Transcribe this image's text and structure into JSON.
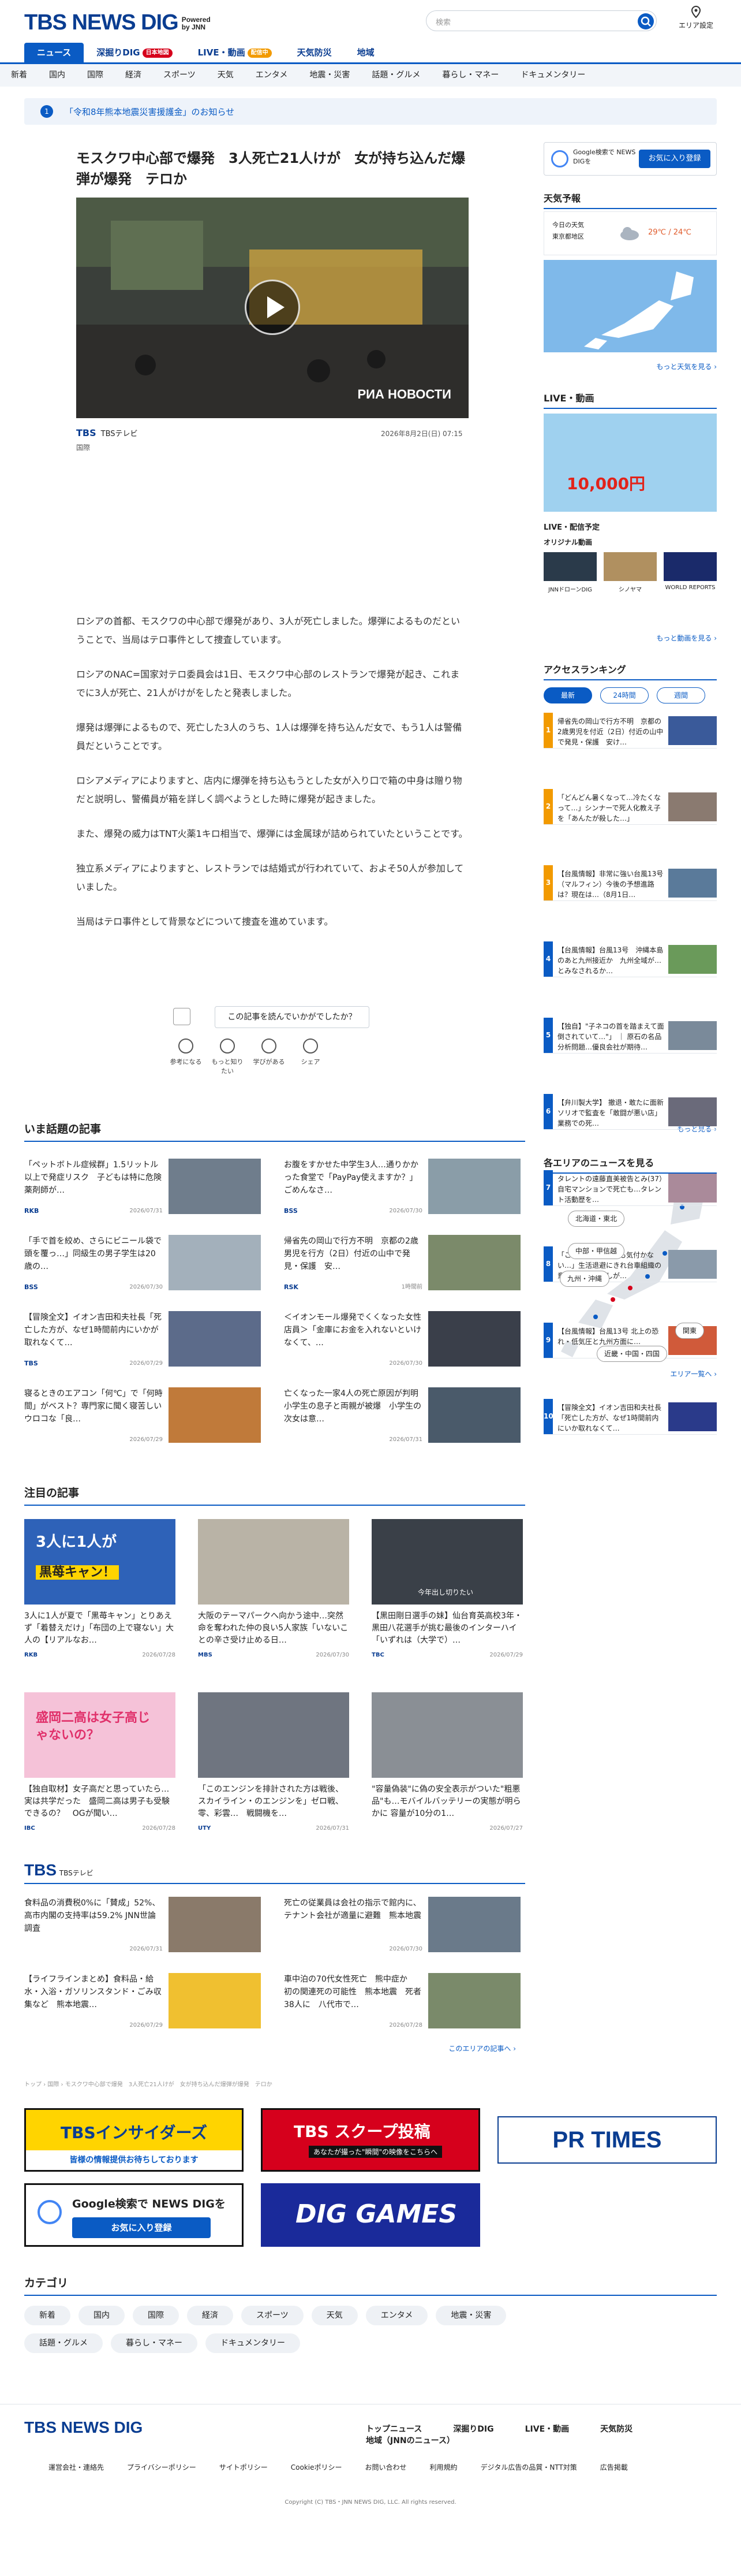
{
  "header": {
    "logo": "TBS NEWS DIG",
    "powered": "Powered",
    "by": "by JNN",
    "search_placeholder": "検索",
    "area_label": "エリア設定"
  },
  "mainnav": [
    {
      "label": "ニュース"
    },
    {
      "label": "深掘りDIG",
      "badge": "日本地図"
    },
    {
      "label": "LIVE・動画",
      "badge": "配信中"
    },
    {
      "label": "天気防災"
    },
    {
      "label": "地域"
    }
  ],
  "subnav": [
    "新着",
    "国内",
    "国際",
    "経済",
    "スポーツ",
    "天気",
    "エンタメ",
    "地震・災害",
    "話題・グルメ",
    "暮らし・マネー",
    "ドキュメンタリー"
  ],
  "notice": {
    "num": "1",
    "text": "「令和8年熊本地震災害援護金」のお知らせ"
  },
  "article": {
    "title": "モスクワ中心部で爆発　3人死亡21人けが　女が持ち込んだ爆弾が爆発　テロか",
    "video_label": "РИА НОВОСТИ",
    "source_logo": "TBS",
    "source": "TBSテレビ",
    "date": "2026年8月2日(日) 07:15",
    "category": "国際",
    "paragraphs": [
      "ロシアの首都、モスクワの中心部で爆発があり、3人が死亡しました。爆弾によるものだということで、当局はテロ事件として捜査しています。",
      "ロシアのNAC=国家対テロ委員会は1日、モスクワ中心部のレストランで爆発が起き、これまでに3人が死亡、21人がけがをしたと発表しました。",
      "爆発は爆弾によるもので、死亡した3人のうち、1人は爆弾を持ち込んだ女で、もう1人は警備員だということです。",
      "ロシアメディアによりますと、店内に爆弾を持ち込もうとした女が入り口で箱の中身は贈り物だと説明し、警備員が箱を詳しく調べようとした時に爆発が起きました。",
      "また、爆発の威力はTNT火薬1キロ相当で、爆弾には金属球が詰められていたということです。",
      "独立系メディアによりますと、レストランでは結婚式が行われていて、およそ50人が参加していました。",
      "当局はテロ事件として背景などについて捜査を進めています。"
    ],
    "ask": "この記事を読んでいかがでしたか？",
    "reactions": [
      "参考になる",
      "もっと知りたい",
      "学びがある",
      "シェア"
    ]
  },
  "trending": {
    "heading": "いま話題の記事",
    "items": [
      {
        "title": "「ペットボトル症候群」1.5リットル以上で発症リスク　子どもは特に危険　薬剤師が…",
        "src": "RKB",
        "date": "2026/07/31"
      },
      {
        "title": "お腹をすかせた中学生3人…通りかかった食堂で「PayPay使えますか？」ごめんなさ…",
        "src": "BSS",
        "date": "2026/07/30"
      },
      {
        "title": "「手で首を絞め、さらにビニール袋で頭を覆っ…」同級生の男子学生は20歳の…",
        "src": "BSS",
        "date": "2026/07/30"
      },
      {
        "title": "帰省先の岡山で行方不明　京都の2歳男児を行方（2日）付近の山中で発見・保護　安…",
        "src": "RSK",
        "date": "1時間前"
      },
      {
        "title": "【冒険全文】イオン吉田和夫社長「死亡した方が、なぜ1時間前内にいかが取れなくて…",
        "src": "TBS",
        "date": "2026/07/29"
      },
      {
        "title": "＜イオンモール爆発でくくなった女性店員＞「金庫にお金を入れないといけなくて、…",
        "src": "",
        "date": "2026/07/30"
      },
      {
        "title": "寝るときのエアコン「何℃」で「何時間」がベスト？専門家に聞く寝苦しいウロコな「良…",
        "src": "",
        "date": "2026/07/29"
      },
      {
        "title": "亡くなった一家4人の死亡原因が判明　小学生の息子と両親が被爆　小学生の次女は意…",
        "src": "",
        "date": "2026/07/31"
      }
    ]
  },
  "featured": {
    "heading": "注目の記事",
    "items": [
      {
        "title": "3人に1人が夏で「黒苺キャン」とりあえず「着替えだけ」「布団の上で寝ない」大人の【リアルなお…",
        "src": "RKB",
        "date": "2026/07/28"
      },
      {
        "title": "大阪のテーマパークへ向かう途中…突然命を奪われた仲の良い5人家族「いないことの辛さ受け止める日…",
        "src": "MBS",
        "date": "2026/07/30"
      },
      {
        "title": "【黒田剛日選手の妹】仙台育英高校3年・黒田八花選手が挑む最後のインターハイ「いずれは（大学で）…",
        "src": "TBC",
        "date": "2026/07/29"
      },
      {
        "title": "【独自取材】女子高だと思っていたら…実は共学だった　盛岡二高は男子も受験できるの？　OGが聞い…",
        "src": "IBC",
        "date": "2026/07/28"
      },
      {
        "title": "「このエンジンを排計された方は戦後、スカイライン・のエンジンを」ゼロ戦、零、彩雲…　戦闘機を…",
        "src": "UTY",
        "date": "2026/07/31"
      },
      {
        "title": "\"容量偽装\"に偽の安全表示がついた\"粗悪品\"も…モバイルバッテリーの実態が明らかに 容量が10分の1…",
        "src": "",
        "date": "2026/07/27"
      }
    ],
    "thumb_texts": [
      "3人に1人が",
      "黒苺キャン！",
      "盛岡二高は女子高じゃないの？",
      "今年出し切りたい"
    ]
  },
  "tbs": {
    "logo": "TBS",
    "sub": "TBSテレビ",
    "items": [
      {
        "title": "食料品の消費税0%に「賛成」52%、高市内閣の支持率は59.2% JNN世論調査",
        "date": "2026/07/31"
      },
      {
        "title": "死亡の従業員は会社の指示で館内に、テナント会社が適量に避難　熊本地震",
        "date": "2026/07/30"
      },
      {
        "title": "【ライフラインまとめ】食料品・給水・入浴・ガソリンスタンド・ごみ収集など　熊本地震…",
        "date": "2026/07/29"
      },
      {
        "title": "車中泊の70代女性死亡　熊中症か　初の関連死の可能性　熊本地震　死者38人に　八代市で…",
        "date": "2026/07/28"
      }
    ],
    "more": "このエリアの記事へ ›"
  },
  "breadcrumb": "トップ › 国際 › モスクワ中心部で爆発　3人死亡21人けが　女が持ち込んだ爆弾が爆発　テロか",
  "banners": {
    "insiders": "TBSインサイダーズ",
    "insiders_sub": "皆様の情報提供お待ちしております",
    "scoop": "TBS スクープ投稿",
    "scoop_sub": "あなたが撮った\"瞬間\"の映像をこちらへ",
    "prtimes": "PR TIMES",
    "google": "Google検索で NEWS DIGを",
    "google_btn": "お気に入り登録",
    "games": "DIG GAMES"
  },
  "category": {
    "heading": "カテゴリ",
    "items": [
      "新着",
      "国内",
      "国際",
      "経済",
      "スポーツ",
      "天気",
      "エンタメ",
      "地震・災害",
      "話題・グルメ",
      "暮らし・マネー",
      "ドキュメンタリー"
    ]
  },
  "sidebar": {
    "google_text": "Google検索で NEWS DIGを",
    "google_btn": "お気に入り登録",
    "weather": {
      "heading": "天気予報",
      "today": "今日の天気",
      "place": "東京都地区",
      "temp": "29℃ / 24℃",
      "more": "もっと天気を見る ›"
    },
    "live": {
      "heading": "LIVE・動画",
      "schedule": "LIVE・配信予定",
      "original": "オリジナル動画",
      "shows": [
        "JNNドローンDIG",
        "シノヤマ",
        "WORLD REPORTS"
      ],
      "banner_text": "10,000円",
      "more": "もっと動画を見る ›"
    },
    "ranking": {
      "heading": "アクセスランキング",
      "tabs": [
        "最新",
        "24時間",
        "週間"
      ],
      "items": [
        "帰省先の岡山で行方不明　京都の2歳男児を付近（2日）付近の山中で発見・保護　安け…",
        "「どんどん暑くなって…冷たくなって…」シンナーで死人化教え子を「あんたが殺した…」",
        "【台風情報】非常に強い台風13号（マルフィン）今後の予想進路は？現在は…（8月1日…",
        "【台風情報】台風13号　沖縄本島のあと九州接近か　九州全域が…とみなされるか…",
        "【独自】\"子ネコの首を踏まえて面倒されていて…\"」 ｜ 原石の名品分析問題…優良会社が期待…",
        "【弁川製大学】 撤退・敢たに面新ソリオで監査を「敢闘が悪い店」業務での死…",
        "タレントの遠藤直美被告とみ(37）自宅マンションで死亡も…タレント活動歴を…",
        "「これまで過ごしても気付かない…」生活退避にきれ台車組織の意義…・やり直しが…",
        "【台風情報】台風13号 北上の恐れ・低気圧と九州方面に…",
        "【冒険全文】イオン吉田和夫社長「死亡した方が、なぜ1時間前内にいか取れなくて…"
      ],
      "more": "もっと見る ›"
    },
    "areas": {
      "heading": "各エリアのニュースを見る",
      "items": [
        "北海道・東北",
        "中部・甲信越",
        "九州・沖縄",
        "関東",
        "近畿・中国・四国"
      ],
      "more": "エリア一覧へ ›"
    }
  },
  "footer": {
    "logo": "TBS NEWS DIG",
    "nav": [
      "トップニュース",
      "深掘りDIG",
      "LIVE・動画",
      "天気防災",
      "地域（JNNのニュース）"
    ],
    "links": [
      "運営会社・連絡先",
      "プライバシーポリシー",
      "サイトポリシー",
      "Cookieポリシー",
      "お問い合わせ",
      "利用規約",
      "デジタル広告の品質・NTT対策",
      "広告掲載"
    ],
    "copyright": "Copyright (C) TBS・JNN NEWS DIG, LLC. All rights reserved."
  },
  "colors": {
    "brand": "#0a3d91",
    "accent": "#0a5bc4",
    "live": "#d6001c"
  }
}
